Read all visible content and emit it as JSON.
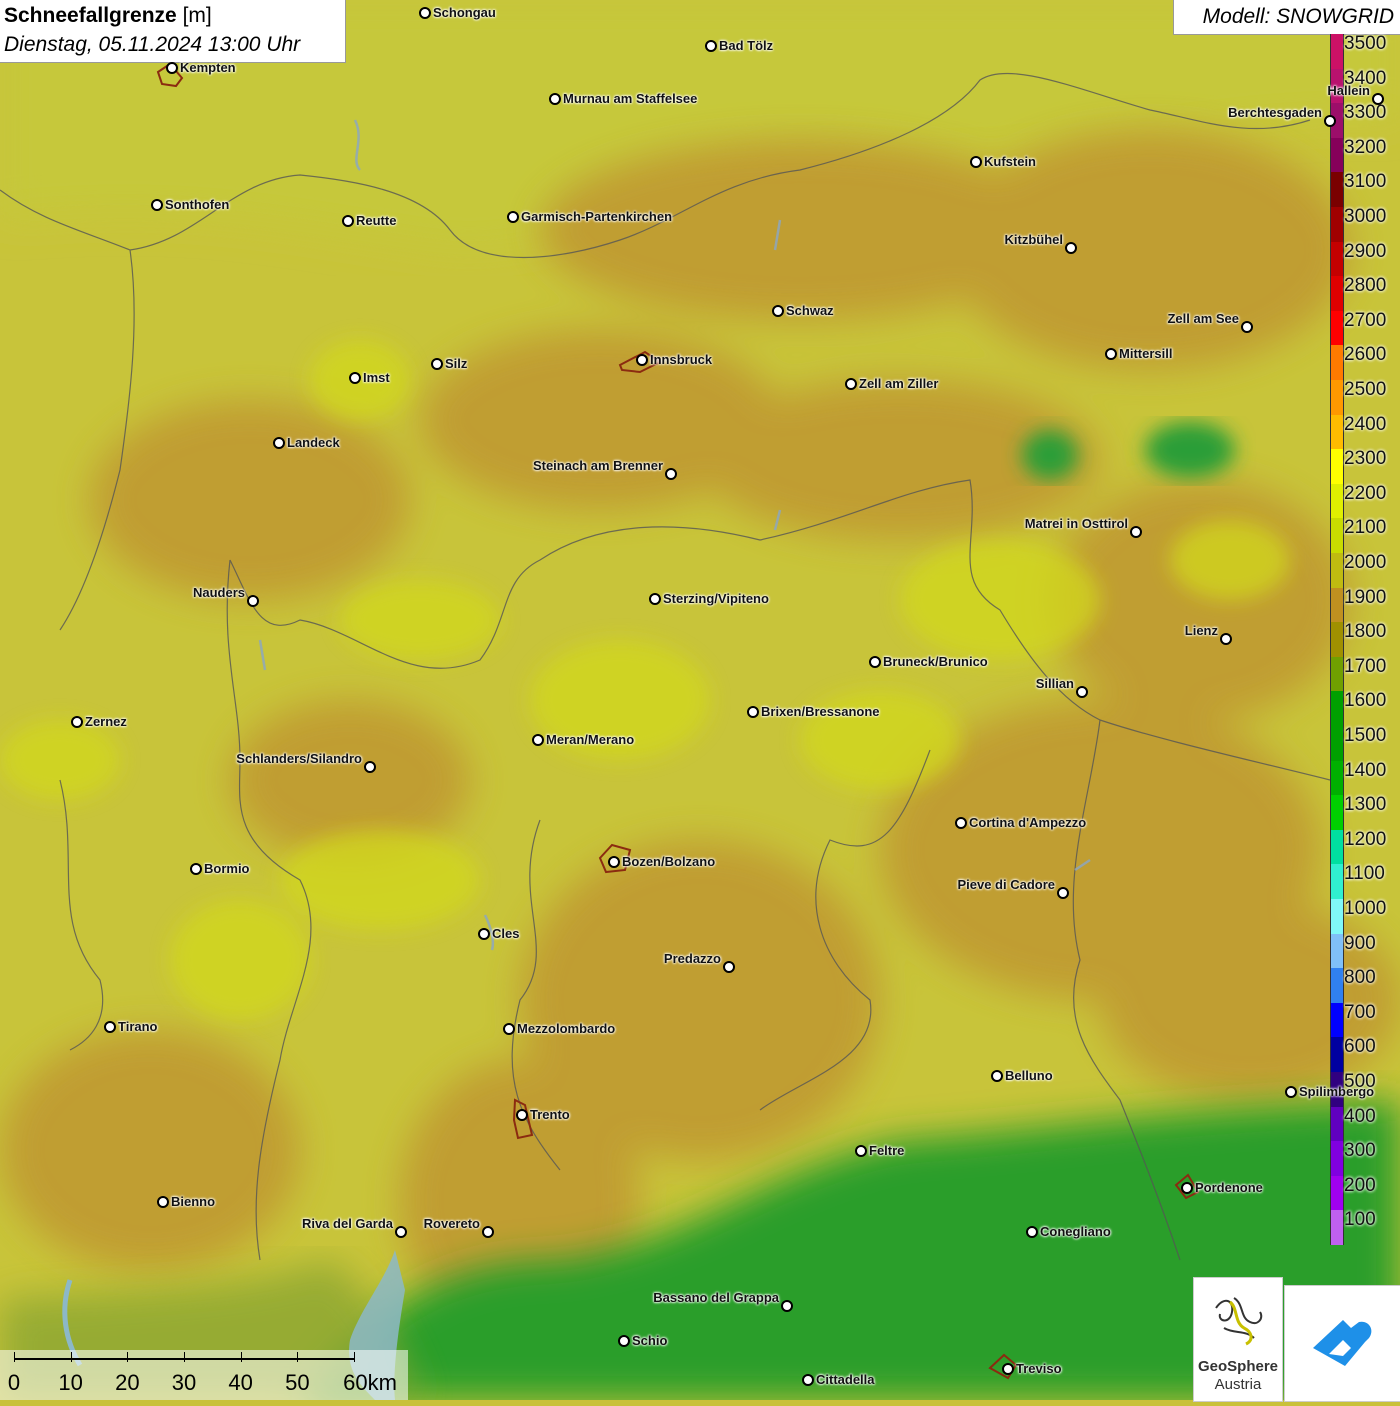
{
  "title": {
    "name": "Schneefallgrenze",
    "unit": "[m]",
    "datetime": "Dienstag, 05.11.2024 13:00 Uhr"
  },
  "model_label": "Modell: SNOWGRID",
  "legend": {
    "labels": [
      "3500",
      "3400",
      "3300",
      "3200",
      "3100",
      "3000",
      "2900",
      "2800",
      "2700",
      "2600",
      "2500",
      "2400",
      "2300",
      "2200",
      "2100",
      "2000",
      "1900",
      "1800",
      "1700",
      "1600",
      "1500",
      "1400",
      "1300",
      "1200",
      "1100",
      "1000",
      "900",
      "800",
      "700",
      "600",
      "500",
      "400",
      "300",
      "200",
      "100"
    ],
    "colors": [
      "#cc1166",
      "#b8126e",
      "#9c0e6a",
      "#86005a",
      "#7a0000",
      "#a00000",
      "#c40000",
      "#e00000",
      "#ff0000",
      "#ff7a00",
      "#ff9800",
      "#ffbb00",
      "#ffff00",
      "#e0f000",
      "#c8dc00",
      "#c0bb10",
      "#c09020",
      "#a09000",
      "#70a000",
      "#00a000",
      "#00a000",
      "#00b000",
      "#00d000",
      "#00e0a0",
      "#30f0d0",
      "#80f8f8",
      "#80c0f8",
      "#3080f0",
      "#0000ff",
      "#0000a0",
      "#300080",
      "#6000c0",
      "#8000e0",
      "#a000f0",
      "#c060f0"
    ]
  },
  "cities": [
    {
      "name": "Schongau"
    },
    {
      "name": "Bad Tölz"
    },
    {
      "name": "Kempten"
    },
    {
      "name": "Murnau am Staffelsee"
    },
    {
      "name": "Hallein"
    },
    {
      "name": "Berchtesgaden"
    },
    {
      "name": "Kufstein"
    },
    {
      "name": "Sonthofen"
    },
    {
      "name": "Reutte"
    },
    {
      "name": "Garmisch-Partenkirchen"
    },
    {
      "name": "Kitzbühel"
    },
    {
      "name": "Schwaz"
    },
    {
      "name": "Zell am See"
    },
    {
      "name": "Innsbruck"
    },
    {
      "name": "Mittersill"
    },
    {
      "name": "Silz"
    },
    {
      "name": "Imst"
    },
    {
      "name": "Zell am Ziller"
    },
    {
      "name": "Landeck"
    },
    {
      "name": "Steinach am Brenner"
    },
    {
      "name": "Matrei in Osttirol"
    },
    {
      "name": "Nauders"
    },
    {
      "name": "Sterzing/Vipiteno"
    },
    {
      "name": "Lienz"
    },
    {
      "name": "Bruneck/Brunico"
    },
    {
      "name": "Sillian"
    },
    {
      "name": "Brixen/Bressanone"
    },
    {
      "name": "Zernez"
    },
    {
      "name": "Meran/Merano"
    },
    {
      "name": "Schlanders/Silandro"
    },
    {
      "name": "Cortina d'Ampezzo"
    },
    {
      "name": "Bozen/Bolzano"
    },
    {
      "name": "Bormio"
    },
    {
      "name": "Pieve di Cadore"
    },
    {
      "name": "Cles"
    },
    {
      "name": "Predazzo"
    },
    {
      "name": "Tirano"
    },
    {
      "name": "Mezzolombardo"
    },
    {
      "name": "Belluno"
    },
    {
      "name": "Spilimbergo"
    },
    {
      "name": "Trento"
    },
    {
      "name": "Feltre"
    },
    {
      "name": "Pordenone"
    },
    {
      "name": "Bienno"
    },
    {
      "name": "Riva del Garda"
    },
    {
      "name": "Rovereto"
    },
    {
      "name": "Conegliano"
    },
    {
      "name": "Bassano del Grappa"
    },
    {
      "name": "Schio"
    },
    {
      "name": "Treviso"
    },
    {
      "name": "Cittadella"
    }
  ],
  "scale": {
    "labels": [
      "0",
      "10",
      "20",
      "30",
      "40",
      "50",
      "60km"
    ]
  },
  "logos": {
    "geosphere_line1": "GeoSphere",
    "geosphere_line2": "Austria"
  }
}
